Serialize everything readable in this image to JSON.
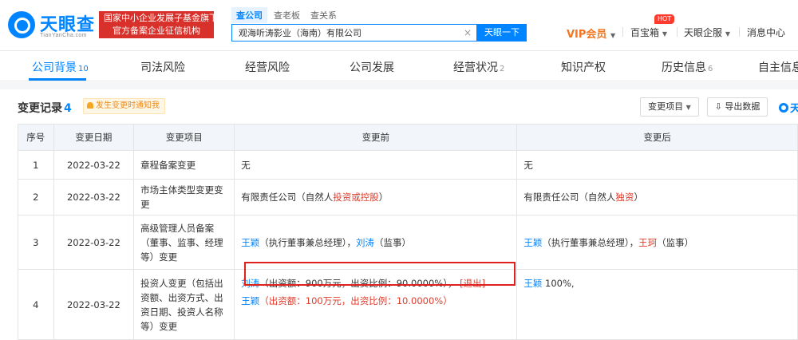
{
  "header": {
    "logo_text": "天眼查",
    "logo_sub": "TianYanCha.com",
    "badge_line1": "国家中小企业发展子基金旗下",
    "badge_line2": "官方备案企业征信机构",
    "search_tabs": [
      "查公司",
      "查老板",
      "查关系"
    ],
    "search_value": "观海听涛影业（海南）有限公司",
    "search_button": "天眼一下",
    "vip": "VIP会员",
    "treasure": "百宝箱",
    "hot": "HOT",
    "enterprise": "天眼企服",
    "messages": "消息中心"
  },
  "tabs": [
    {
      "label": "公司背景",
      "count": "10"
    },
    {
      "label": "司法风险",
      "count": ""
    },
    {
      "label": "经营风险",
      "count": ""
    },
    {
      "label": "公司发展",
      "count": ""
    },
    {
      "label": "经营状况",
      "count": "2"
    },
    {
      "label": "知识产权",
      "count": ""
    },
    {
      "label": "历史信息",
      "count": "6"
    },
    {
      "label": "自主信息",
      "count": ""
    }
  ],
  "records": {
    "title": "变更记录",
    "count": "4",
    "notify": "发生变更时通知我",
    "filter_button": "变更项目",
    "export_button": "导出数据",
    "side_logo": "天",
    "columns": [
      "序号",
      "变更日期",
      "变更项目",
      "变更前",
      "变更后"
    ],
    "rows": [
      {
        "no": "1",
        "date": "2022-03-22",
        "item": "章程备案变更",
        "before": "无",
        "after": "无"
      },
      {
        "no": "2",
        "date": "2022-03-22",
        "item": "市场主体类型变更变更",
        "before_a": "有限责任公司（自然人",
        "before_b": "投资或控股",
        "before_c": "）",
        "after_a": "有限责任公司（自然人",
        "after_b": "独资",
        "after_c": "）"
      },
      {
        "no": "3",
        "date": "2022-03-22",
        "item": "高级管理人员备案（董事、监事、经理等）变更",
        "before_n1": "王颖",
        "before_r1": "（执行董事兼总经理），",
        "before_n2": "刘涛",
        "before_r2": "（监事）",
        "after_n1": "王颖",
        "after_r1": "（执行董事兼总经理），",
        "after_n2": "王珂",
        "after_r2": "（监事）"
      },
      {
        "no": "4",
        "date": "2022-03-22",
        "item": "投资人变更（包括出资额、出资方式、出资日期、投资人名称等）变更",
        "b1_name": "刘涛",
        "b1_detail": "（出资额：900万元，出资比例：90.0000%），",
        "b1_flag": "[退出]",
        "b2_name": "王颖",
        "b2_detail_a": "（出资额：",
        "b2_detail_b": "100万元",
        "b2_detail_c": "，出资比例：",
        "b2_detail_d": "10.0000%",
        "b2_detail_e": "）",
        "after_name": "王颖",
        "after_pct": "100%,"
      }
    ]
  },
  "colors": {
    "accent": "#0084ff",
    "red": "#e03a2b",
    "vip": "#f4751f",
    "badge": "#d8312b"
  }
}
